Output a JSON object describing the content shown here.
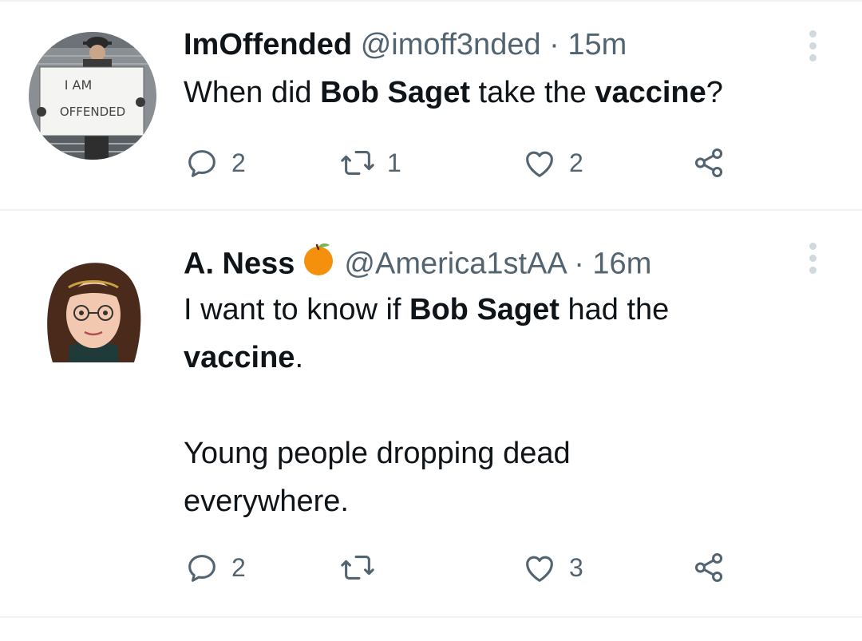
{
  "tweets": [
    {
      "display_name": "ImOffended",
      "handle": "@imoff3nded",
      "separator": "·",
      "time": "15m",
      "avatar_sign_line1": "I AM",
      "avatar_sign_line2": "OFFENDED",
      "text_parts": [
        "When did ",
        "Bob Saget",
        " take the ",
        "vaccine",
        "?"
      ],
      "replies": "2",
      "retweets": "1",
      "likes": "2"
    },
    {
      "display_name": "A. Ness",
      "badge_icon": "orange-emoji-icon",
      "handle": "@America1stAA",
      "separator": "·",
      "time": "16m",
      "text_parts": [
        "I want to know if ",
        "Bob Saget",
        " had the",
        "vaccine",
        "."
      ],
      "text_para2": [
        "Young people dropping dead",
        "everywhere."
      ],
      "replies": "2",
      "retweets": "",
      "likes": "3"
    }
  ],
  "colors": {
    "text": "#0f1419",
    "secondary": "#536471",
    "divider": "#eff3f4",
    "more_dots": "#cfd9de",
    "orange": "#f4900c"
  }
}
